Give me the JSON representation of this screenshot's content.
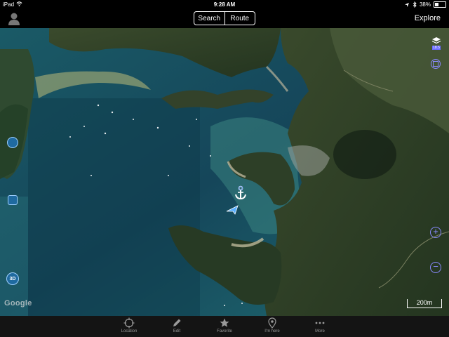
{
  "status": {
    "carrier": "iPad",
    "time": "9:28 AM",
    "battery": "38%",
    "battery_level": 0.38
  },
  "nav": {
    "segments": [
      "Search",
      "Route"
    ],
    "explore": "Explore"
  },
  "map": {
    "attribution": "Google",
    "scale_label": "200m",
    "controls": {
      "layers_badge": "18.5",
      "mode_3d": "3D"
    }
  },
  "tabbar": {
    "items": [
      {
        "label": "Location",
        "icon": "crosshair-icon"
      },
      {
        "label": "Edit",
        "icon": "pencil-icon"
      },
      {
        "label": "Favorite",
        "icon": "star-icon"
      },
      {
        "label": "I'm here",
        "icon": "map-pin-icon"
      },
      {
        "label": "More",
        "icon": "ellipsis-icon"
      }
    ]
  },
  "colors": {
    "accent": "#6b6bff",
    "water_deep": "#143f4d",
    "water_shallow": "#1f6b72",
    "forest": "#2e3f26"
  }
}
